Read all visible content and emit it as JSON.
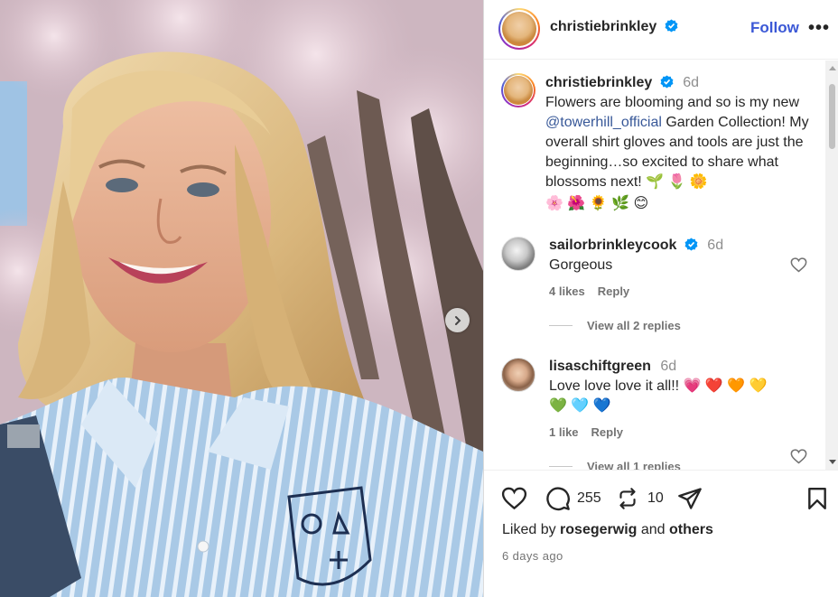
{
  "post": {
    "username": "christiebrinkley",
    "follow_label": "Follow",
    "more_label": "•••",
    "carousel_next_icon": "chevron-right-icon"
  },
  "caption": {
    "username": "christiebrinkley",
    "time": "6d",
    "text_before": "Flowers are blooming and so is my new ",
    "mention": "@towerhill_official",
    "text_after": " Garden Collection! My overall shirt gloves and tools are just the beginning…so excited to share what blossoms next! 🌱 🌷 🌼",
    "emoji_line": "🌸 🌺 🌻 🌿 😊"
  },
  "comments": [
    {
      "username": "sailorbrinkleycook",
      "time": "6d",
      "text": "Gorgeous",
      "likes": "4 likes",
      "reply": "Reply",
      "view_replies": "View all 2 replies"
    },
    {
      "username": "lisaschiftgreen",
      "time": "6d",
      "text": "Love love love it all!! 💗 ❤️ 🧡 💛",
      "text2": "💚 🩵 💙",
      "likes": "1 like",
      "reply": "Reply",
      "view_replies": "View all 1 replies"
    }
  ],
  "actions": {
    "comment_count": "255",
    "repost_count": "10"
  },
  "liked_by": {
    "prefix": "Liked by ",
    "user": "rosegerwig",
    "middle": " and ",
    "others": "others"
  },
  "date": "6 days ago",
  "colors": {
    "follow": "#3b58d6",
    "verified": "#0095f6",
    "mention": "#385898"
  }
}
